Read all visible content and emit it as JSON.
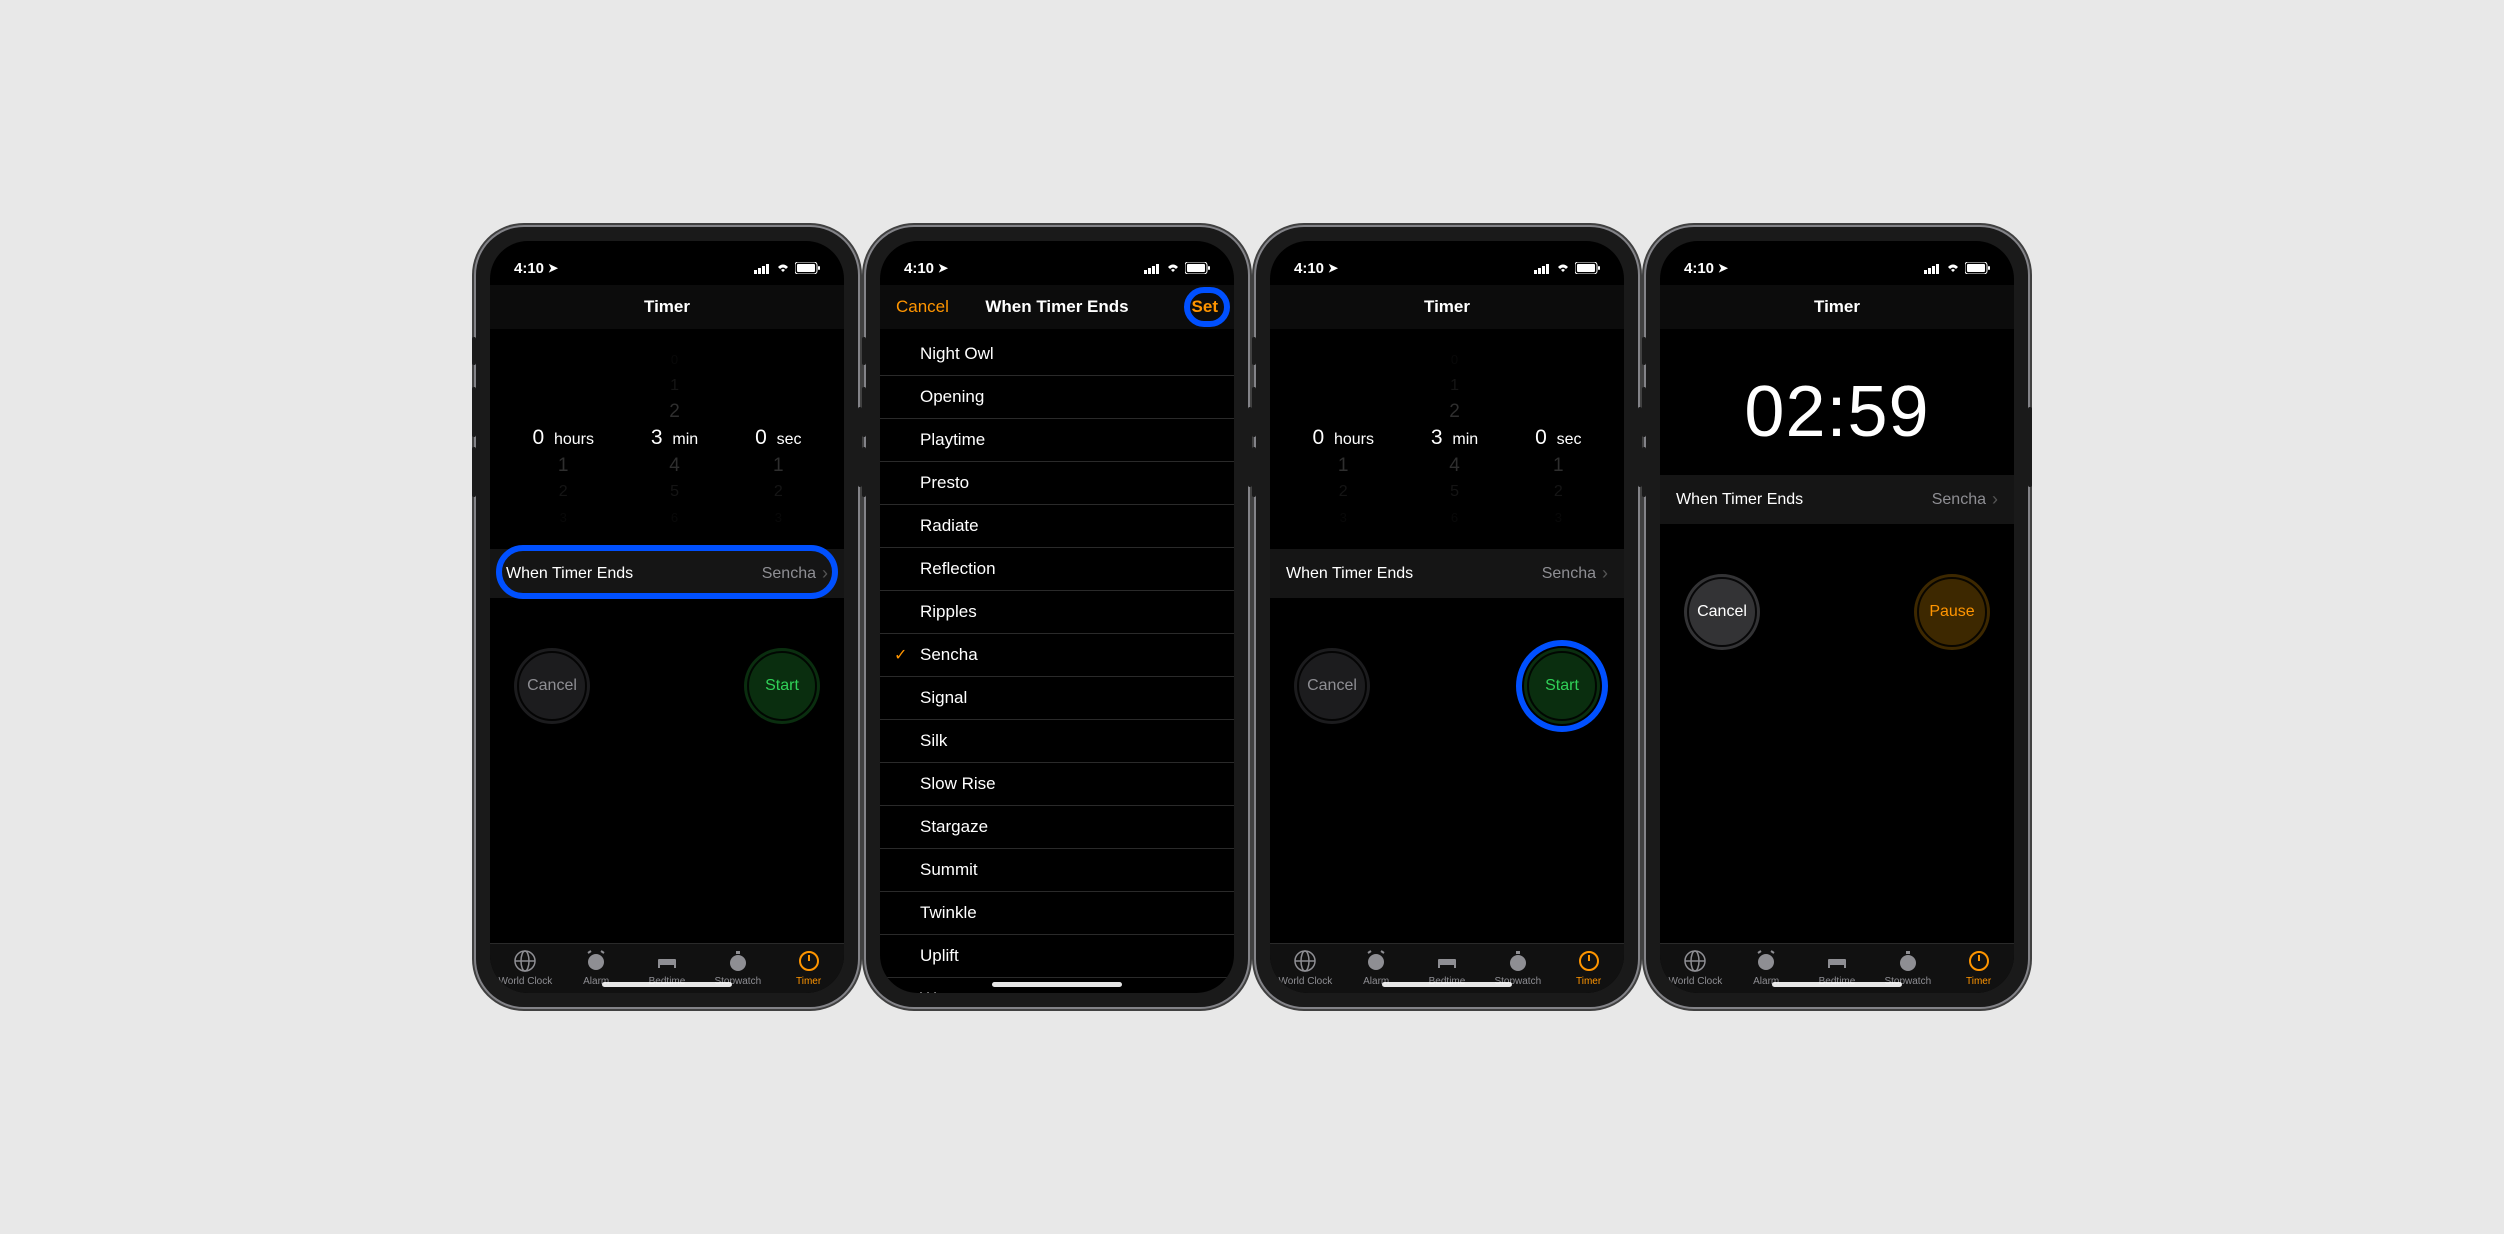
{
  "status": {
    "time": "4:10",
    "wifi": true,
    "battery": true,
    "signal": 4
  },
  "tabs": [
    "World Clock",
    "Alarm",
    "Bedtime",
    "Stopwatch",
    "Timer"
  ],
  "activeTab": "Timer",
  "screen1": {
    "title": "Timer",
    "picker": {
      "hours": "0",
      "min": "3",
      "sec": "0",
      "hLabel": "hours",
      "mLabel": "min",
      "sLabel": "sec"
    },
    "whenLabel": "When Timer Ends",
    "whenValue": "Sencha",
    "cancel": "Cancel",
    "start": "Start"
  },
  "screen2": {
    "leftBtn": "Cancel",
    "title": "When Timer Ends",
    "rightBtn": "Set",
    "sounds": [
      "Night Owl",
      "Opening",
      "Playtime",
      "Presto",
      "Radiate",
      "Reflection",
      "Ripples",
      "Sencha",
      "Signal",
      "Silk",
      "Slow Rise",
      "Stargaze",
      "Summit",
      "Twinkle",
      "Uplift",
      "Waves"
    ],
    "selected": "Sencha"
  },
  "screen3": {
    "title": "Timer",
    "picker": {
      "hours": "0",
      "min": "3",
      "sec": "0",
      "hLabel": "hours",
      "mLabel": "min",
      "sLabel": "sec"
    },
    "whenLabel": "When Timer Ends",
    "whenValue": "Sencha",
    "cancel": "Cancel",
    "start": "Start"
  },
  "screen4": {
    "title": "Timer",
    "countdown": "02:59",
    "whenLabel": "When Timer Ends",
    "whenValue": "Sencha",
    "cancel": "Cancel",
    "pause": "Pause"
  }
}
